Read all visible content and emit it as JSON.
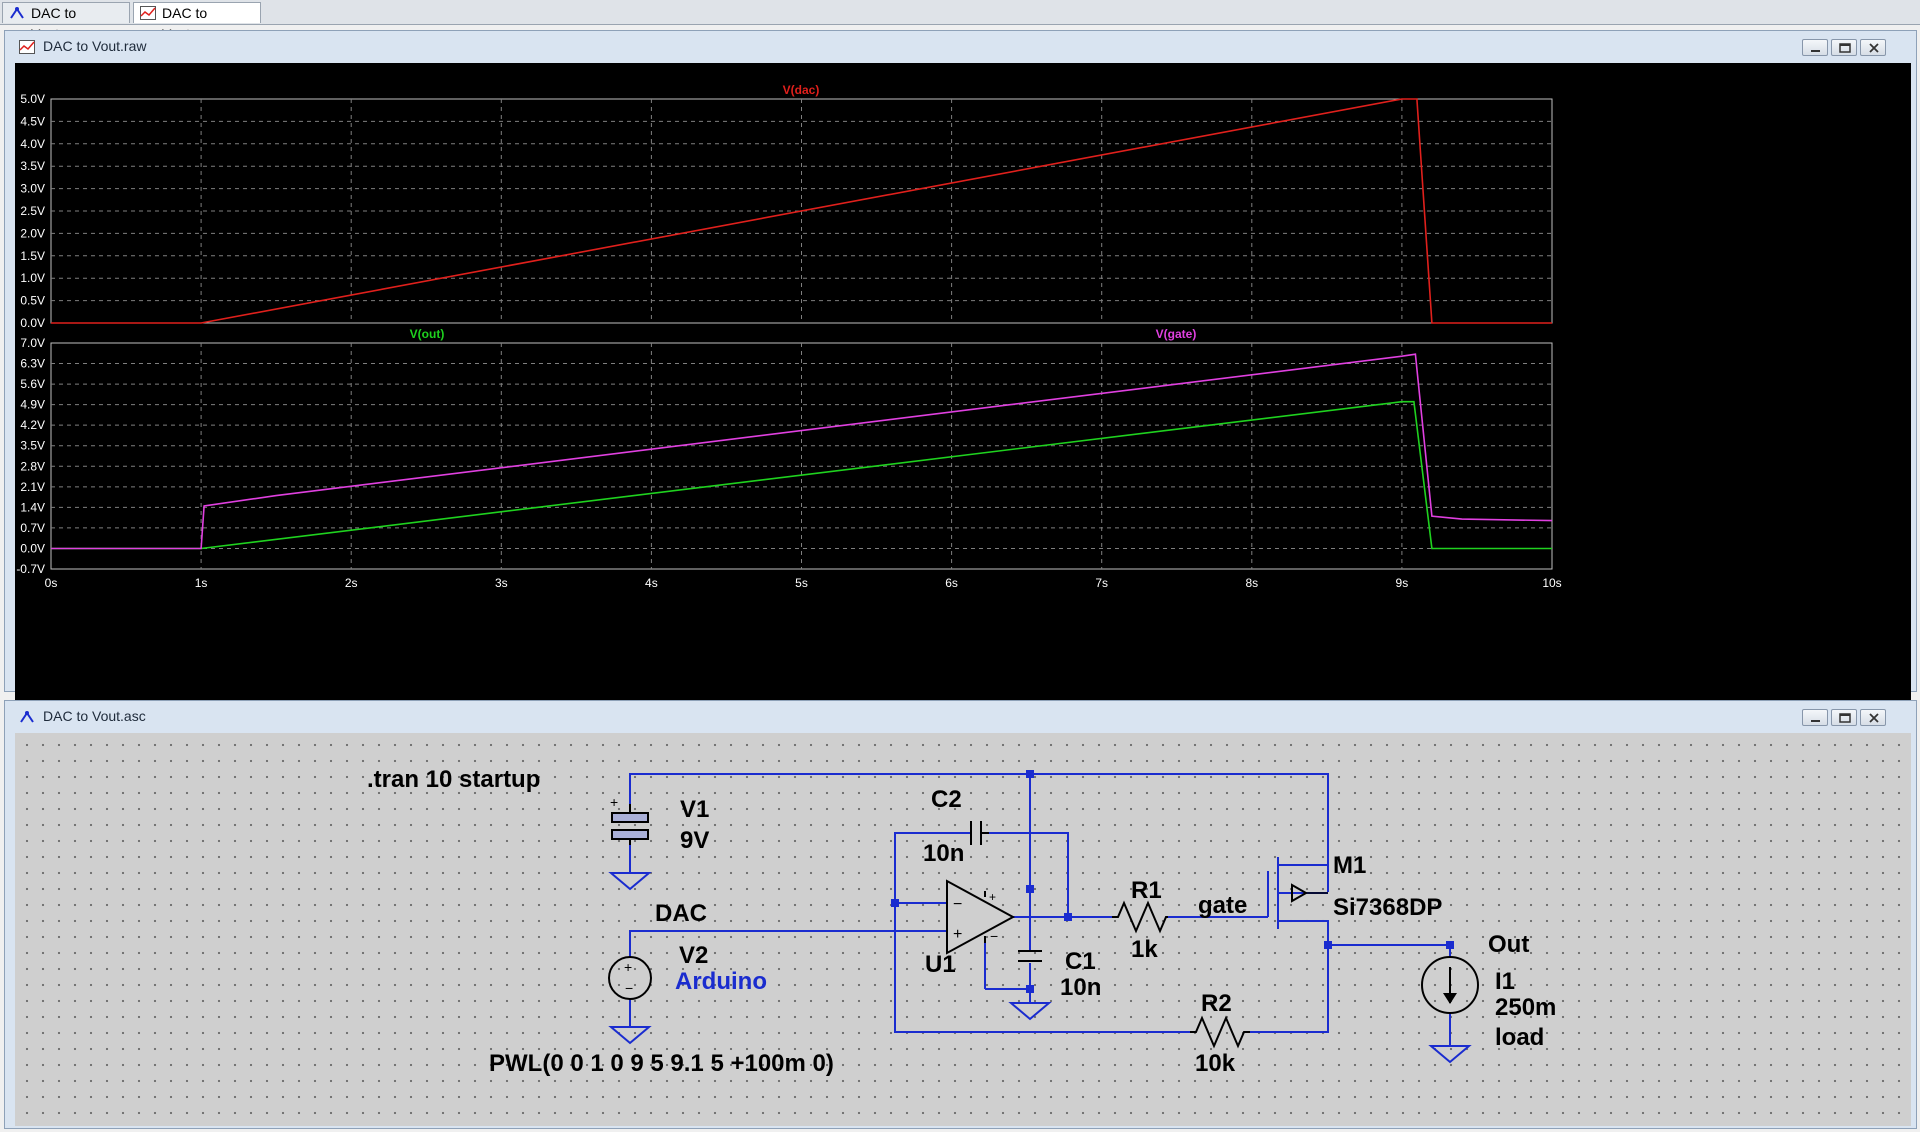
{
  "tabs": [
    {
      "label": "DAC to Vout.asc",
      "active": false,
      "icon": "schematic-icon"
    },
    {
      "label": "DAC to Vout.raw",
      "active": true,
      "icon": "waveform-icon"
    }
  ],
  "waveform_window": {
    "title": "DAC to Vout.raw",
    "controls": [
      "minimize-icon",
      "restore-icon",
      "close-icon"
    ]
  },
  "schematic_window": {
    "title": "DAC to Vout.asc",
    "controls": [
      "minimize-icon",
      "restore-icon",
      "close-icon"
    ]
  },
  "colors": {
    "v_dac": "#e0201c",
    "v_out": "#1fd21f",
    "v_gate": "#e040e0",
    "wire": "#1a2ccf",
    "plot_bg": "#000000",
    "grid": "#7f7f7f"
  },
  "chart_data": [
    {
      "type": "line",
      "title": "",
      "series": [
        {
          "name": "V(dac)",
          "x": [
            0,
            1,
            9,
            9.1,
            9.2,
            10
          ],
          "y": [
            0,
            0,
            5,
            5,
            0,
            0
          ]
        }
      ],
      "xlim": [
        0,
        10
      ],
      "ylim": [
        0,
        5
      ],
      "x_ticks": [
        "0s",
        "1s",
        "2s",
        "3s",
        "4s",
        "5s",
        "6s",
        "7s",
        "8s",
        "9s",
        "10s"
      ],
      "y_ticks": [
        "0.0V",
        "0.5V",
        "1.0V",
        "1.5V",
        "2.0V",
        "2.5V",
        "3.0V",
        "3.5V",
        "4.0V",
        "4.5V",
        "5.0V"
      ],
      "grid": true,
      "legend": "top"
    },
    {
      "type": "line",
      "title": "",
      "series": [
        {
          "name": "V(out)",
          "x": [
            0,
            1,
            9,
            9.08,
            9.2,
            10
          ],
          "y": [
            0,
            0,
            5.0,
            5.0,
            0,
            0
          ]
        },
        {
          "name": "V(gate)",
          "x": [
            0,
            1,
            1.02,
            1.5,
            9,
            9.09,
            9.2,
            9.4,
            10
          ],
          "y": [
            0,
            0,
            1.45,
            1.8,
            6.55,
            6.62,
            1.1,
            1.0,
            0.95
          ]
        }
      ],
      "xlim": [
        0,
        10
      ],
      "ylim": [
        -0.7,
        7.0
      ],
      "x_ticks": [
        "0s",
        "1s",
        "2s",
        "3s",
        "4s",
        "5s",
        "6s",
        "7s",
        "8s",
        "9s",
        "10s"
      ],
      "y_ticks": [
        "-0.7V",
        "0.0V",
        "0.7V",
        "1.4V",
        "2.1V",
        "2.8V",
        "3.5V",
        "4.2V",
        "4.9V",
        "5.6V",
        "6.3V",
        "7.0V"
      ],
      "grid": true,
      "legend": "top"
    }
  ],
  "schematic": {
    "directive": ".tran 10 startup",
    "v1": {
      "name": "V1",
      "value": "9V"
    },
    "v2": {
      "name": "V2",
      "value": "Arduino"
    },
    "pwl": "PWL(0 0 1 0 9 5 9.1 5 +100m 0)",
    "dac_label": "DAC",
    "c2": {
      "name": "C2",
      "value": "10n"
    },
    "c1": {
      "name": "C1",
      "value": "10n"
    },
    "u1": {
      "name": "U1"
    },
    "r1": {
      "name": "R1",
      "value": "1k"
    },
    "gate_label": "gate",
    "m1": {
      "name": "M1",
      "value": "Si7368DP"
    },
    "out_label": "Out",
    "r2": {
      "name": "R2",
      "value": "10k"
    },
    "i1": {
      "name": "I1",
      "value": "250m",
      "note": "load"
    }
  }
}
